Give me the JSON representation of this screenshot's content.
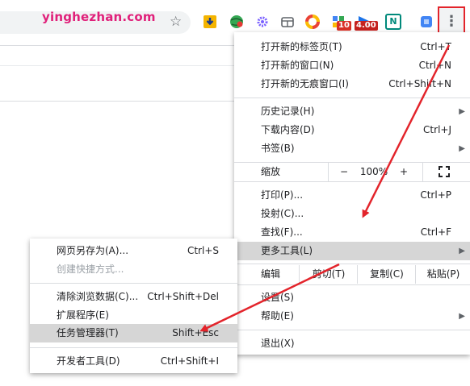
{
  "watermark": "yinghezhan.com",
  "toolbar": {
    "bookmark_icon": "star-icon",
    "extensions": [
      {
        "name": "download-ext-icon",
        "color": "#f4b400"
      },
      {
        "name": "globe-ext-icon",
        "color": "#34a853"
      },
      {
        "name": "gear-ext-icon",
        "color": "#7b61ff"
      },
      {
        "name": "tabs-ext-icon",
        "color": "#5f6368"
      },
      {
        "name": "color-ring-ext-icon",
        "color": "#ea4335"
      },
      {
        "name": "puzzle-ext-icon",
        "color": "#4285f4",
        "badge": "10",
        "badge_color": "#d93025"
      },
      {
        "name": "flag-ext-icon",
        "color": "#1a73e8",
        "badge": "4.00",
        "badge_color": "#c5221f"
      },
      {
        "name": "n-ext-icon",
        "color": "#00897b",
        "text": "N"
      },
      {
        "name": "cube-ext-icon",
        "color": "#4285f4"
      }
    ],
    "menu_icon": "more-vert-icon"
  },
  "main_menu": {
    "items": [
      {
        "label": "打开新的标签页(T)",
        "shortcut": "Ctrl+T"
      },
      {
        "label": "打开新的窗口(N)",
        "shortcut": "Ctrl+N"
      },
      {
        "label": "打开新的无痕窗口(I)",
        "shortcut": "Ctrl+Shift+N"
      },
      {
        "label": "历史记录(H)",
        "shortcut": ""
      },
      {
        "label": "下载内容(D)",
        "shortcut": "Ctrl+J"
      },
      {
        "label": "书签(B)",
        "shortcut": ""
      },
      {
        "label": "打印(P)...",
        "shortcut": "Ctrl+P"
      },
      {
        "label": "投射(C)...",
        "shortcut": ""
      },
      {
        "label": "查找(F)...",
        "shortcut": "Ctrl+F"
      },
      {
        "label": "更多工具(L)",
        "shortcut": ""
      },
      {
        "label": "设置(S)",
        "shortcut": ""
      },
      {
        "label": "帮助(E)",
        "shortcut": ""
      },
      {
        "label": "退出(X)",
        "shortcut": ""
      }
    ],
    "zoom": {
      "label": "缩放",
      "minus": "−",
      "value": "100%",
      "plus": "+",
      "fullscreen_icon": "fullscreen-icon"
    },
    "edit": {
      "label": "编辑",
      "cut": "剪切(T)",
      "copy": "复制(C)",
      "paste": "粘贴(P)"
    }
  },
  "sub_menu": {
    "items": [
      {
        "label": "网页另存为(A)...",
        "shortcut": "Ctrl+S"
      },
      {
        "label": "创建快捷方式...",
        "shortcut": ""
      },
      {
        "label": "清除浏览数据(C)...",
        "shortcut": "Ctrl+Shift+Del"
      },
      {
        "label": "扩展程序(E)",
        "shortcut": ""
      },
      {
        "label": "任务管理器(T)",
        "shortcut": "Shift+Esc"
      },
      {
        "label": "开发者工具(D)",
        "shortcut": "Ctrl+Shift+I"
      }
    ]
  },
  "annotation_color": "#e3242b"
}
